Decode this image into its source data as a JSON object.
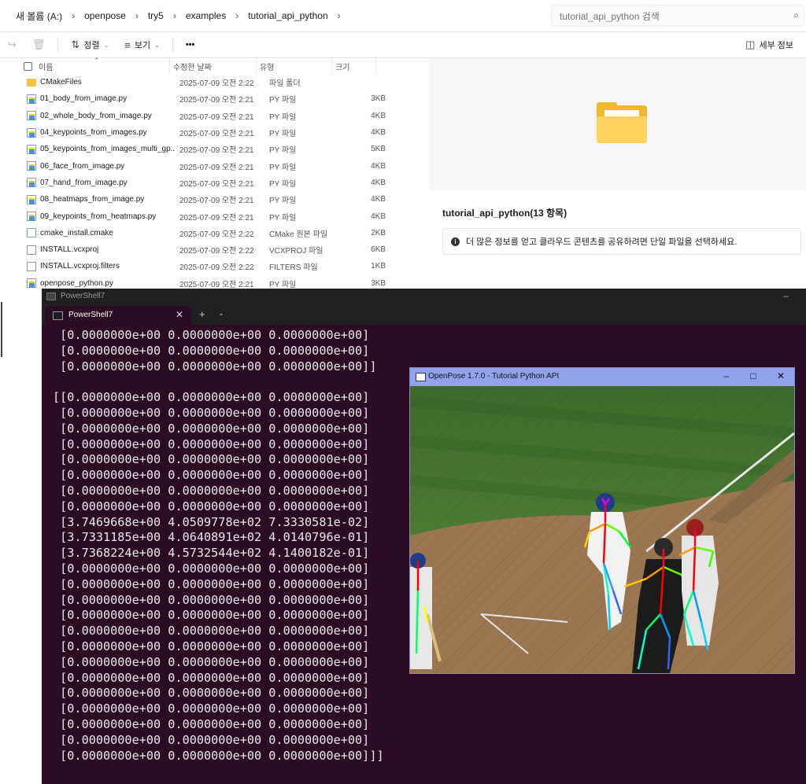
{
  "explorer": {
    "breadcrumbs": [
      "새 볼륨 (A:)",
      "openpose",
      "try5",
      "examples",
      "tutorial_api_python"
    ],
    "search_placeholder": "tutorial_api_python 검색",
    "toolbar": {
      "sort": "정렬",
      "view": "보기",
      "more": "•••",
      "details": "세부 정보"
    },
    "columns": {
      "name": "이름",
      "date": "수정한 날짜",
      "type": "유형",
      "size": "크기"
    },
    "files": [
      {
        "name": "CMakeFiles",
        "date": "2025-07-09 오전 2:22",
        "type": "파일 폴더",
        "size": "",
        "icon": "folder"
      },
      {
        "name": "01_body_from_image.py",
        "date": "2025-07-09 오전 2:21",
        "type": "PY 파일",
        "size": "3KB",
        "icon": "python"
      },
      {
        "name": "02_whole_body_from_image.py",
        "date": "2025-07-09 오전 2:21",
        "type": "PY 파일",
        "size": "4KB",
        "icon": "python"
      },
      {
        "name": "04_keypoints_from_images.py",
        "date": "2025-07-09 오전 2:21",
        "type": "PY 파일",
        "size": "4KB",
        "icon": "python"
      },
      {
        "name": "05_keypoints_from_images_multi_gp...",
        "date": "2025-07-09 오전 2:21",
        "type": "PY 파일",
        "size": "5KB",
        "icon": "python"
      },
      {
        "name": "06_face_from_image.py",
        "date": "2025-07-09 오전 2:21",
        "type": "PY 파일",
        "size": "4KB",
        "icon": "python"
      },
      {
        "name": "07_hand_from_image.py",
        "date": "2025-07-09 오전 2:21",
        "type": "PY 파일",
        "size": "4KB",
        "icon": "python"
      },
      {
        "name": "08_heatmaps_from_image.py",
        "date": "2025-07-09 오전 2:21",
        "type": "PY 파일",
        "size": "4KB",
        "icon": "python"
      },
      {
        "name": "09_keypoints_from_heatmaps.py",
        "date": "2025-07-09 오전 2:21",
        "type": "PY 파일",
        "size": "4KB",
        "icon": "python"
      },
      {
        "name": "cmake_install.cmake",
        "date": "2025-07-09 오전 2:22",
        "type": "CMake 원본 파일",
        "size": "2KB",
        "icon": "document"
      },
      {
        "name": "INSTALL.vcxproj",
        "date": "2025-07-09 오전 2:22",
        "type": "VCXPROJ 파일",
        "size": "6KB",
        "icon": "document"
      },
      {
        "name": "INSTALL.vcxproj.filters",
        "date": "2025-07-09 오전 2:22",
        "type": "FILTERS 파일",
        "size": "1KB",
        "icon": "document"
      },
      {
        "name": "openpose_python.py",
        "date": "2025-07-09 오전 2:21",
        "type": "PY 파일",
        "size": "3KB",
        "icon": "python"
      }
    ],
    "preview": {
      "title": "tutorial_api_python(13 항목)",
      "info": "더 많은 정보를 얻고 클라우드 콘텐츠를 공유하려면 단일 파일을 선택하세요."
    }
  },
  "terminal": {
    "window_title": "PowerShell7",
    "tab_label": "PowerShell7",
    "lines": [
      " [0.0000000e+00 0.0000000e+00 0.0000000e+00]",
      " [0.0000000e+00 0.0000000e+00 0.0000000e+00]",
      " [0.0000000e+00 0.0000000e+00 0.0000000e+00]]",
      "",
      "[[0.0000000e+00 0.0000000e+00 0.0000000e+00]",
      " [0.0000000e+00 0.0000000e+00 0.0000000e+00]",
      " [0.0000000e+00 0.0000000e+00 0.0000000e+00]",
      " [0.0000000e+00 0.0000000e+00 0.0000000e+00]",
      " [0.0000000e+00 0.0000000e+00 0.0000000e+00]",
      " [0.0000000e+00 0.0000000e+00 0.0000000e+00]",
      " [0.0000000e+00 0.0000000e+00 0.0000000e+00]",
      " [0.0000000e+00 0.0000000e+00 0.0000000e+00]",
      " [3.7469668e+00 4.0509778e+02 7.3330581e-02]",
      " [3.7331185e+00 4.0640891e+02 4.0140796e-01]",
      " [3.7368224e+00 4.5732544e+02 4.1400182e-01]",
      " [0.0000000e+00 0.0000000e+00 0.0000000e+00]",
      " [0.0000000e+00 0.0000000e+00 0.0000000e+00]",
      " [0.0000000e+00 0.0000000e+00 0.0000000e+00]",
      " [0.0000000e+00 0.0000000e+00 0.0000000e+00]",
      " [0.0000000e+00 0.0000000e+00 0.0000000e+00]",
      " [0.0000000e+00 0.0000000e+00 0.0000000e+00]",
      " [0.0000000e+00 0.0000000e+00 0.0000000e+00]",
      " [0.0000000e+00 0.0000000e+00 0.0000000e+00]",
      " [0.0000000e+00 0.0000000e+00 0.0000000e+00]",
      " [0.0000000e+00 0.0000000e+00 0.0000000e+00]",
      " [0.0000000e+00 0.0000000e+00 0.0000000e+00]",
      " [0.0000000e+00 0.0000000e+00 0.0000000e+00]",
      " [0.0000000e+00 0.0000000e+00 0.0000000e+00]]]"
    ]
  },
  "openpose": {
    "window_title": "OpenPose 1.7.0 - Tutorial Python API",
    "image_subject": "baseball players with pose skeleton overlay"
  }
}
